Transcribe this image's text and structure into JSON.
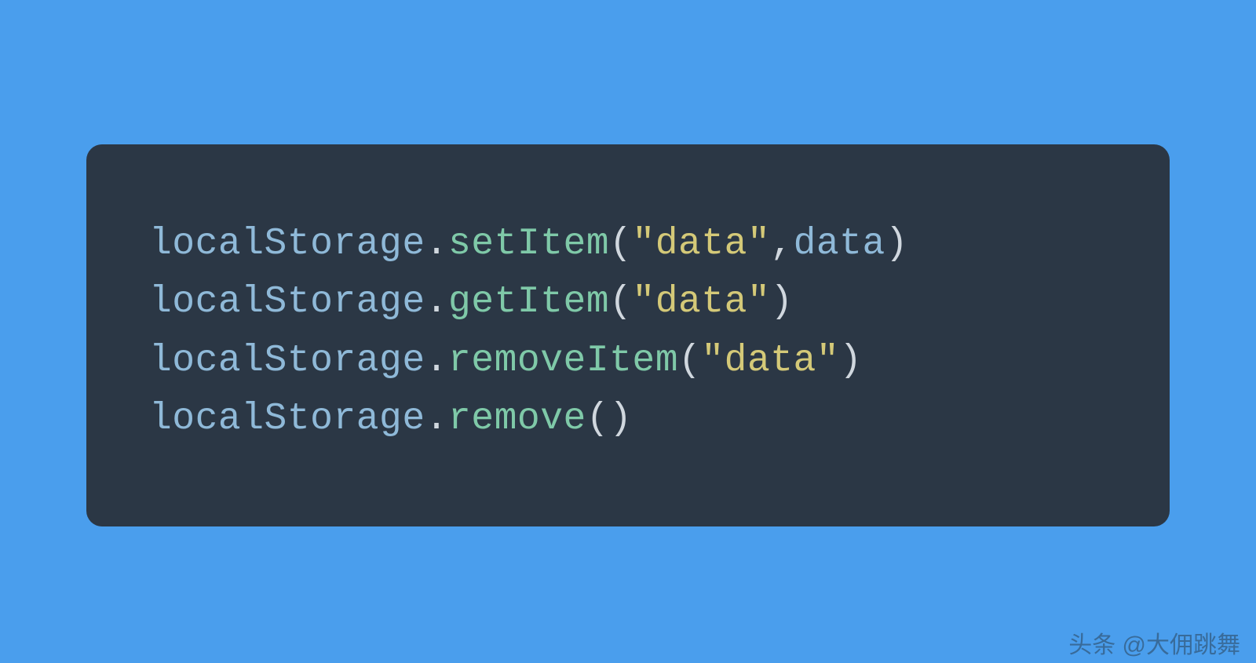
{
  "code": {
    "lines": [
      {
        "object": "localStorage",
        "method": "setItem",
        "args": [
          {
            "type": "string",
            "value": "\"data\""
          },
          {
            "type": "var",
            "value": "data"
          }
        ]
      },
      {
        "object": "localStorage",
        "method": "getItem",
        "args": [
          {
            "type": "string",
            "value": "\"data\""
          }
        ]
      },
      {
        "object": "localStorage",
        "method": "removeItem",
        "args": [
          {
            "type": "string",
            "value": "\"data\""
          }
        ]
      },
      {
        "object": "localStorage",
        "method": "remove",
        "args": []
      }
    ]
  },
  "watermark": "头条 @大佣跳舞",
  "colors": {
    "background": "#4a9eed",
    "codeBackground": "#2b3745",
    "object": "#8fb9d8",
    "method": "#7fc9a8",
    "string": "#d4c978",
    "punctuation": "#d0d7de"
  }
}
